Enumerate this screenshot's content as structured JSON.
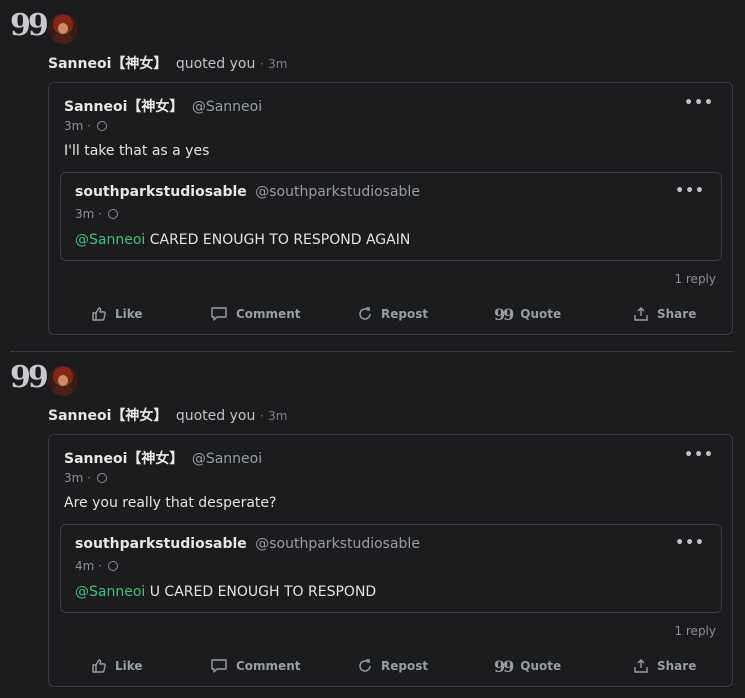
{
  "notifications": [
    {
      "headline": {
        "name": "Sanneoi【神女】",
        "action": "quoted you",
        "separator": "·",
        "time": "3m"
      },
      "post": {
        "name": "Sanneoi【神女】",
        "handle": "@Sanneoi",
        "time": "3m",
        "separator": "·",
        "text": "I'll take that as a yes",
        "quoted": {
          "name": "southparkstudiosable",
          "handle": "@southparkstudiosable",
          "time": "3m",
          "separator": "·",
          "mention": "@Sanneoi",
          "text": " CARED ENOUGH TO RESPOND AGAIN"
        },
        "replies": "1 reply"
      }
    },
    {
      "headline": {
        "name": "Sanneoi【神女】",
        "action": "quoted you",
        "separator": "·",
        "time": "3m"
      },
      "post": {
        "name": "Sanneoi【神女】",
        "handle": "@Sanneoi",
        "time": "3m",
        "separator": "·",
        "text": "Are you really that desperate?",
        "quoted": {
          "name": "southparkstudiosable",
          "handle": "@southparkstudiosable",
          "time": "4m",
          "separator": "·",
          "mention": "@Sanneoi",
          "text": " U CARED ENOUGH TO RESPOND"
        },
        "replies": "1 reply"
      }
    }
  ],
  "actions": {
    "like": "Like",
    "comment": "Comment",
    "repost": "Repost",
    "quote": "Quote",
    "share": "Share"
  },
  "icons": {
    "quote": "quote-icon",
    "globe": "globe-icon",
    "more": "more-icon"
  },
  "colors": {
    "background": "#1b1c1e",
    "border": "#3a3c40",
    "mention": "#3fbf7f"
  }
}
